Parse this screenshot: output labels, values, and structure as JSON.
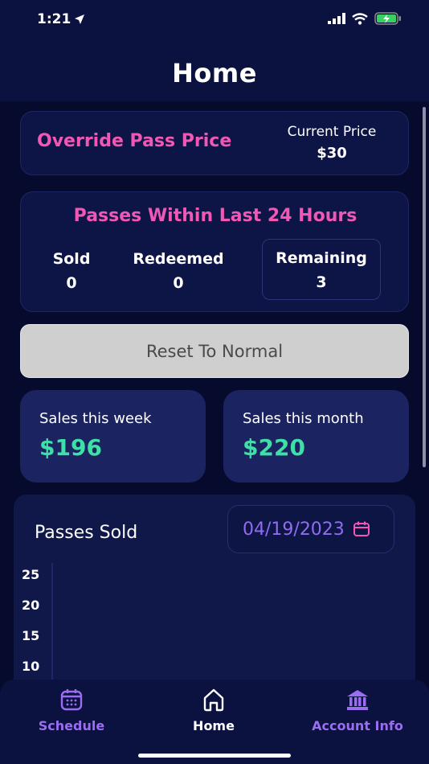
{
  "status": {
    "time": "1:21"
  },
  "header": {
    "title": "Home"
  },
  "override": {
    "title": "Override Pass Price",
    "price_label": "Current Price",
    "price_value": "$30"
  },
  "passes": {
    "title": "Passes Within Last 24 Hours",
    "stats": [
      {
        "label": "Sold",
        "value": "0"
      },
      {
        "label": "Redeemed",
        "value": "0"
      },
      {
        "label": "Remaining",
        "value": "3"
      }
    ]
  },
  "reset": {
    "label": "Reset To Normal"
  },
  "sales": {
    "week_label": "Sales this week",
    "week_value": "$196",
    "month_label": "Sales this month",
    "month_value": "$220"
  },
  "chart": {
    "title": "Passes Sold",
    "date": "04/19/2023"
  },
  "chart_data": {
    "type": "bar",
    "title": "Passes Sold",
    "y_ticks": [
      "25",
      "20",
      "15",
      "10"
    ],
    "values": []
  },
  "tabs": [
    {
      "label": "Schedule",
      "icon": "calendar-icon"
    },
    {
      "label": "Home",
      "icon": "home-icon"
    },
    {
      "label": "Account Info",
      "icon": "bank-icon"
    }
  ],
  "colors": {
    "accent_pink": "#f257b4",
    "accent_purple": "#9b6df3",
    "accent_green": "#3fe0a8",
    "background": "#060b2e"
  }
}
